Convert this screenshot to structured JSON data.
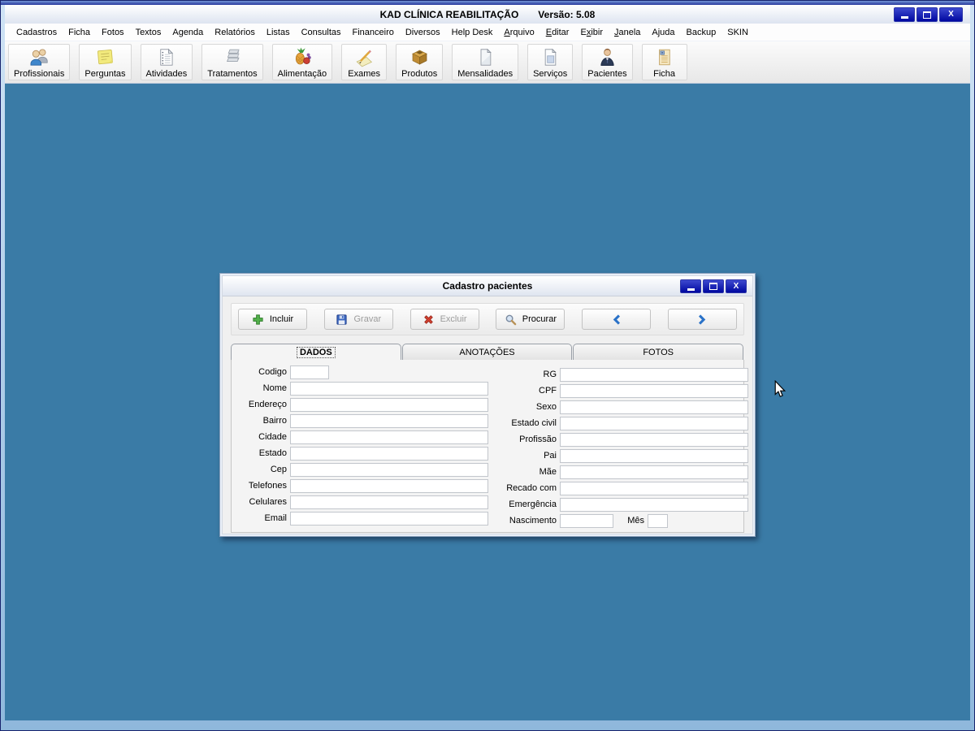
{
  "window": {
    "title": "KAD CLÍNICA REABILITAÇÃO",
    "version": "Versão: 5.08"
  },
  "icons": {
    "close": "X"
  },
  "colors": {
    "client_background": "#3a7ba6",
    "caption_button_blue": "#0008a0",
    "disabled_text": "#9c9c9c",
    "incluir_green": "#52b04a",
    "excluir_red": "#d44030",
    "chevron_blue": "#2a72c8"
  },
  "menubar": {
    "items": [
      {
        "pre": "Cadastros",
        "key": "",
        "post": ""
      },
      {
        "pre": "Ficha",
        "key": "",
        "post": ""
      },
      {
        "pre": "Fotos",
        "key": "",
        "post": ""
      },
      {
        "pre": "Textos",
        "key": "",
        "post": ""
      },
      {
        "pre": "Agenda",
        "key": "",
        "post": ""
      },
      {
        "pre": "Relatórios",
        "key": "",
        "post": ""
      },
      {
        "pre": "Listas",
        "key": "",
        "post": ""
      },
      {
        "pre": "Consultas",
        "key": "",
        "post": ""
      },
      {
        "pre": "Financeiro",
        "key": "",
        "post": ""
      },
      {
        "pre": "Diversos",
        "key": "",
        "post": ""
      },
      {
        "pre": "Help Desk",
        "key": "",
        "post": ""
      },
      {
        "pre": "",
        "key": "A",
        "post": "rquivo"
      },
      {
        "pre": "",
        "key": "E",
        "post": "ditar"
      },
      {
        "pre": "E",
        "key": "x",
        "post": "ibir"
      },
      {
        "pre": "",
        "key": "J",
        "post": "anela"
      },
      {
        "pre": "Ajuda",
        "key": "",
        "post": ""
      },
      {
        "pre": "Backup",
        "key": "",
        "post": ""
      },
      {
        "pre": "SKIN",
        "key": "",
        "post": ""
      }
    ]
  },
  "toolbar": {
    "buttons": [
      {
        "label": "Profissionais",
        "icon": "professionals-icon"
      },
      {
        "label": "Perguntas",
        "icon": "note-icon"
      },
      {
        "label": "Atividades",
        "icon": "notepad-icon"
      },
      {
        "label": "Tratamentos",
        "icon": "trays-icon"
      },
      {
        "label": "Alimentação",
        "icon": "fruit-icon"
      },
      {
        "label": "Exames",
        "icon": "pencil-paper-icon"
      },
      {
        "label": "Produtos",
        "icon": "box-icon"
      },
      {
        "label": "Mensalidades",
        "icon": "sheet-icon"
      },
      {
        "label": "Serviços",
        "icon": "form-sheet-icon"
      },
      {
        "label": "Pacientes",
        "icon": "patient-icon"
      },
      {
        "label": "Ficha",
        "icon": "record-sheet-icon"
      }
    ]
  },
  "dialog": {
    "title": "Cadastro pacientes",
    "toolbar": {
      "buttons": [
        {
          "label": "Incluir",
          "icon": "plus-icon",
          "enabled": true
        },
        {
          "label": "Gravar",
          "icon": "save-icon",
          "enabled": false
        },
        {
          "label": "Excluir",
          "icon": "delete-icon",
          "enabled": false
        },
        {
          "label": "Procurar",
          "icon": "search-icon",
          "enabled": true
        }
      ],
      "nav": [
        {
          "icon": "chevron-left-icon"
        },
        {
          "icon": "chevron-right-icon"
        }
      ]
    },
    "tabs": [
      {
        "label": "DADOS",
        "active": true
      },
      {
        "label": "ANOTAÇÕES",
        "active": false
      },
      {
        "label": "FOTOS",
        "active": false
      }
    ],
    "form": {
      "left_fields": [
        {
          "label": "Codigo",
          "value": "",
          "small": true
        },
        {
          "label": "Nome",
          "value": ""
        },
        {
          "label": "Endereço",
          "value": ""
        },
        {
          "label": "Bairro",
          "value": ""
        },
        {
          "label": "Cidade",
          "value": ""
        },
        {
          "label": "Estado",
          "value": ""
        },
        {
          "label": "Cep",
          "value": ""
        },
        {
          "label": "Telefones",
          "value": ""
        },
        {
          "label": "Celulares",
          "value": ""
        },
        {
          "label": "Email",
          "value": ""
        }
      ],
      "right_fields": [
        {
          "label": "RG",
          "value": ""
        },
        {
          "label": "CPF",
          "value": ""
        },
        {
          "label": "Sexo",
          "value": ""
        },
        {
          "label": "Estado civil",
          "value": ""
        },
        {
          "label": "Profissão",
          "value": ""
        },
        {
          "label": "Pai",
          "value": ""
        },
        {
          "label": "Mãe",
          "value": ""
        },
        {
          "label": "Recado com",
          "value": ""
        },
        {
          "label": "Emergência",
          "value": ""
        }
      ],
      "birth": {
        "label": "Nascimento",
        "value": "",
        "month_label": "Mês",
        "month_value": ""
      }
    }
  }
}
